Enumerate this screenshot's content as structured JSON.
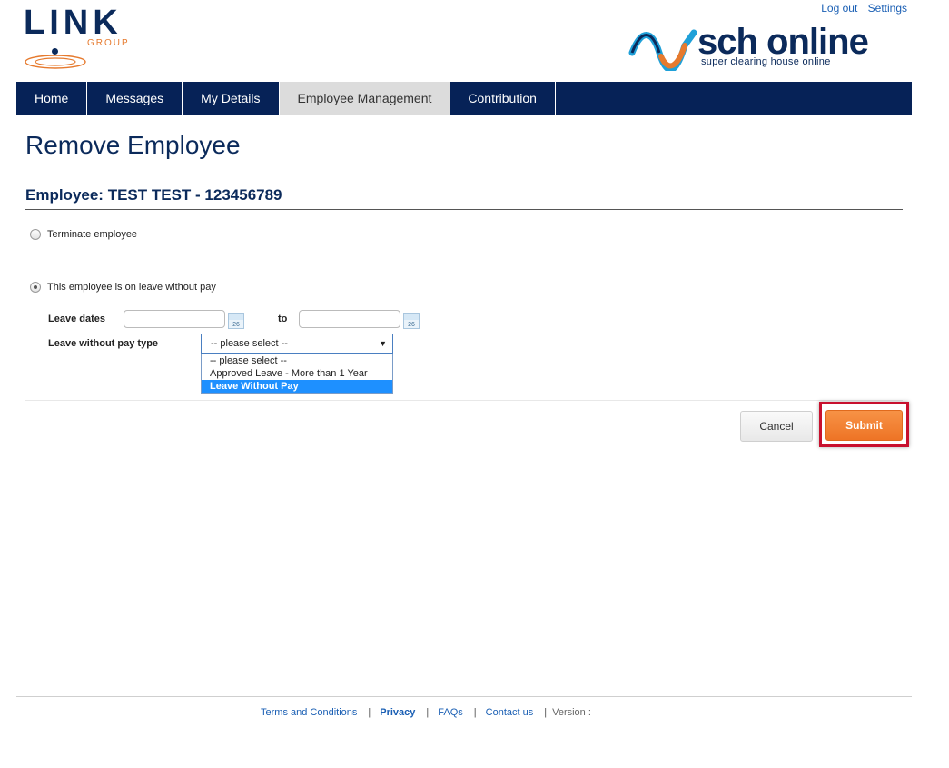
{
  "header": {
    "link_logo_word": "LINK",
    "link_logo_group": "GROUP",
    "top_links": [
      "Log out",
      "Settings"
    ],
    "sch_logo_word": "sch online",
    "sch_logo_tagline": "super clearing house online"
  },
  "nav": {
    "items": [
      "Home",
      "Messages",
      "My Details",
      "Employee Management",
      "Contribution"
    ],
    "active": "Employee Management"
  },
  "page": {
    "title": "Remove Employee",
    "employee_heading": "Employee: TEST TEST - 123456789"
  },
  "form": {
    "option_terminate": "Terminate employee",
    "option_leave": "This employee is on leave without pay",
    "selected_option": "leave",
    "leave_dates_label": "Leave dates",
    "from_value": "",
    "to_label": "to",
    "to_value": "",
    "calendar_icon_text": "26",
    "lwop_type_label": "Leave without pay type",
    "lwop_selected": "-- please select --",
    "lwop_options": [
      "-- please select --",
      "Approved Leave - More than 1 Year",
      "Leave Without Pay"
    ],
    "lwop_highlighted": "Leave Without Pay"
  },
  "buttons": {
    "cancel": "Cancel",
    "submit": "Submit"
  },
  "footer": {
    "links": [
      "Terms and Conditions",
      "Privacy",
      "FAQs",
      "Contact us"
    ],
    "version_label": "Version :"
  },
  "colors": {
    "nav_bg": "#062257",
    "brand_navy": "#0b2a5b",
    "accent_orange": "#ee7426",
    "highlight_red": "#c8102e"
  }
}
